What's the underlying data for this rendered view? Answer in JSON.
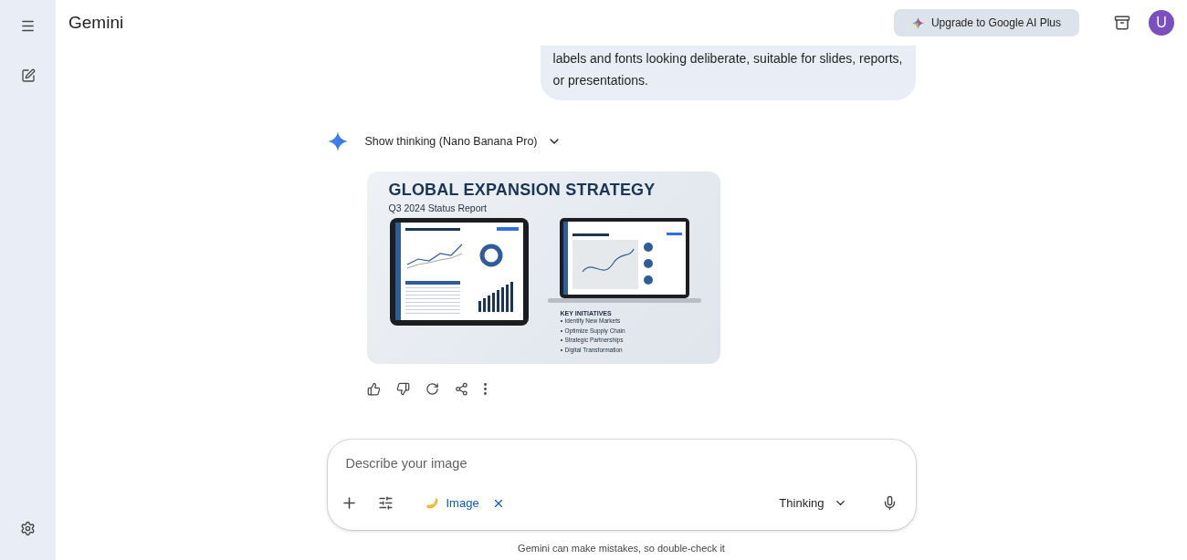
{
  "header": {
    "title": "Gemini",
    "upgrade_button": "Upgrade to Google AI Plus",
    "avatar": "U"
  },
  "user_message": {
    "lines": [
      "labels and fonts looking deliberate, suitable for slides, reports,",
      "or presentations."
    ]
  },
  "response": {
    "thinking_toggle": "Show thinking (Nano Banana Pro)",
    "image": {
      "title": "GLOBAL EXPANSION STRATEGY",
      "subtitle": "Q3 2024 Status Report",
      "list_heading": "KEY INITIATIVES",
      "items": [
        "Identify New Markets",
        "Optimize Supply Chain",
        "Strategic Partnerships",
        "Digital Transformation"
      ]
    }
  },
  "prompt": {
    "placeholder": "Describe your image",
    "tool_chip": "Image",
    "mode": "Thinking"
  },
  "disclaimer": "Gemini can make mistakes, so double-check it"
}
